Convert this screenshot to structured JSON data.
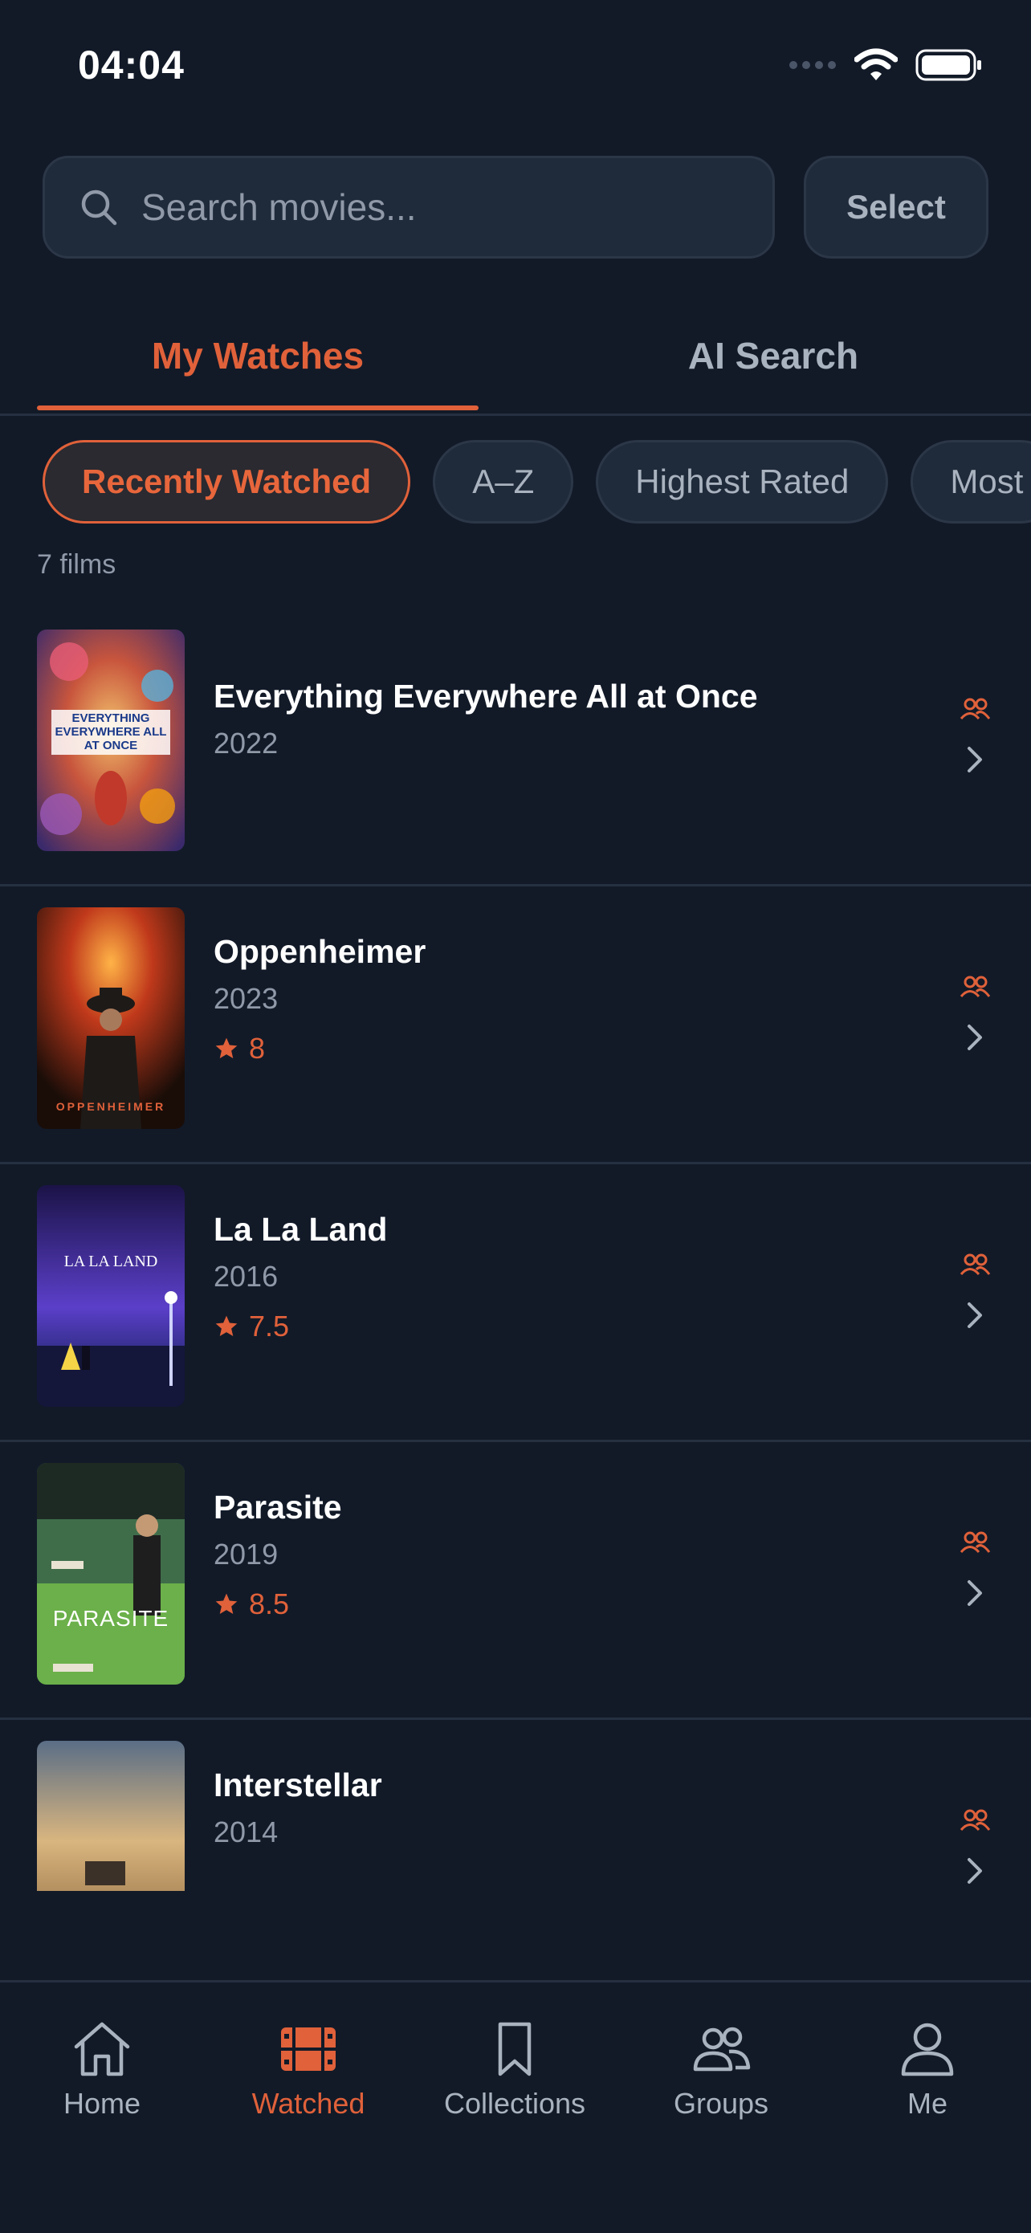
{
  "status_bar": {
    "time": "04:04"
  },
  "search": {
    "placeholder": "Search movies...",
    "value": ""
  },
  "select_label": "Select",
  "tabs": [
    {
      "label": "My Watches",
      "active": true
    },
    {
      "label": "AI Search",
      "active": false
    }
  ],
  "sort_chips": [
    {
      "label": "Recently Watched",
      "active": true
    },
    {
      "label": "A–Z",
      "active": false
    },
    {
      "label": "Highest Rated",
      "active": false
    },
    {
      "label": "Most",
      "active": false
    }
  ],
  "film_count": "7 films",
  "movies": [
    {
      "title": "Everything Everywhere All at Once",
      "year": "2022",
      "rating": "",
      "poster_text": "EVERYTHING EVERYWHERE ALL AT ONCE"
    },
    {
      "title": "Oppenheimer",
      "year": "2023",
      "rating": "8",
      "poster_text": "OPPENHEIMER"
    },
    {
      "title": "La La Land",
      "year": "2016",
      "rating": "7.5",
      "poster_text": "LA LA LAND"
    },
    {
      "title": "Parasite",
      "year": "2019",
      "rating": "8.5",
      "poster_text": "PARASITE"
    },
    {
      "title": "Interstellar",
      "year": "2014",
      "rating": "",
      "poster_text": ""
    }
  ],
  "bottom_nav": [
    {
      "label": "Home",
      "icon": "home-icon",
      "active": false
    },
    {
      "label": "Watched",
      "icon": "film-icon",
      "active": true
    },
    {
      "label": "Collections",
      "icon": "bookmark-icon",
      "active": false
    },
    {
      "label": "Groups",
      "icon": "groups-icon",
      "active": false
    },
    {
      "label": "Me",
      "icon": "person-icon",
      "active": false
    }
  ],
  "colors": {
    "accent": "#e0613a",
    "background": "#121a28",
    "surface": "#1f2a3a",
    "muted": "#8f99a8"
  }
}
